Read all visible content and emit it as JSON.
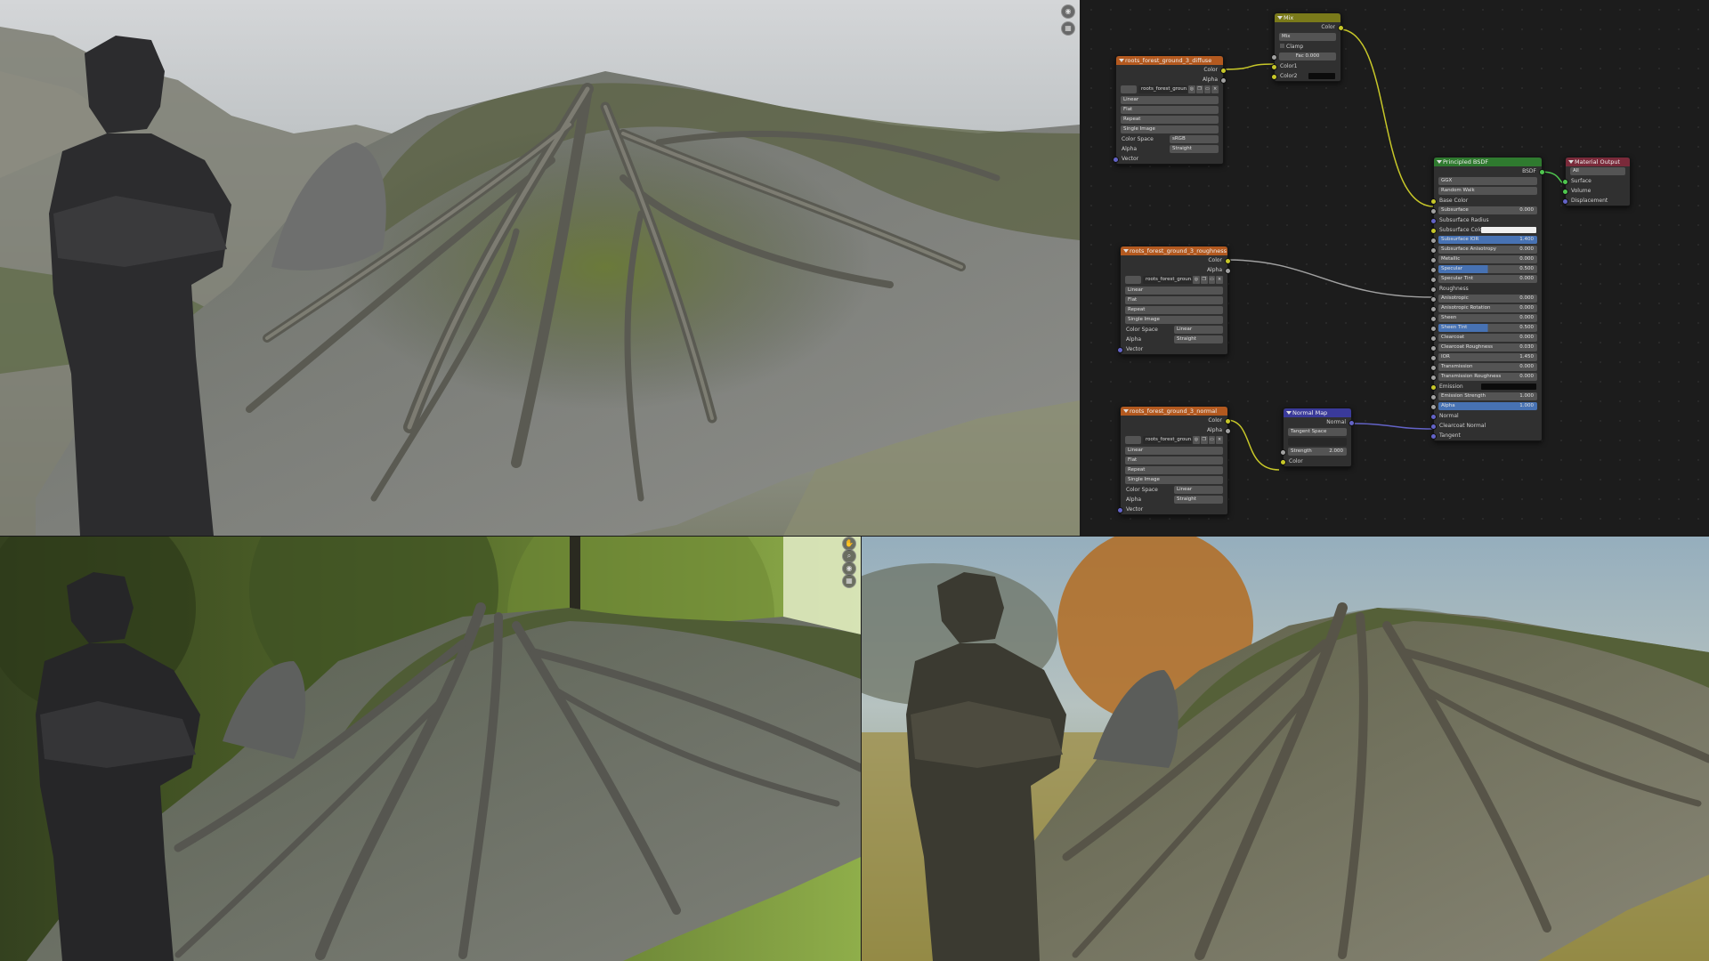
{
  "node_editor": {
    "nodes": {
      "tex_diffuse": {
        "title": "roots_forest_ground_3_diffuse",
        "out_color": "Color",
        "out_alpha": "Alpha",
        "image_name": "roots_forest_groun...",
        "interpolation": "Linear",
        "projection": "Flat",
        "extension": "Repeat",
        "source": "Single Image",
        "color_space_label": "Color Space",
        "color_space": "sRGB",
        "alpha_label": "Alpha",
        "alpha_mode": "Straight",
        "in_vector": "Vector"
      },
      "tex_roughness": {
        "title": "roots_forest_ground_3_roughness",
        "out_color": "Color",
        "out_alpha": "Alpha",
        "image_name": "roots_forest_groun...",
        "interpolation": "Linear",
        "projection": "Flat",
        "extension": "Repeat",
        "source": "Single Image",
        "color_space_label": "Color Space",
        "color_space": "Linear",
        "alpha_label": "Alpha",
        "alpha_mode": "Straight",
        "in_vector": "Vector"
      },
      "tex_normal": {
        "title": "roots_forest_ground_3_normal",
        "out_color": "Color",
        "out_alpha": "Alpha",
        "image_name": "roots_forest_groun...",
        "interpolation": "Linear",
        "projection": "Flat",
        "extension": "Repeat",
        "source": "Single Image",
        "color_space_label": "Color Space",
        "color_space": "Linear",
        "alpha_label": "Alpha",
        "alpha_mode": "Straight",
        "in_vector": "Vector"
      },
      "mix": {
        "title": "Mix",
        "out_color": "Color",
        "blend": "Mix",
        "clamp": "Clamp",
        "fac_label": "Fac",
        "fac_value": "0.000",
        "in_color1": "Color1",
        "in_color2": "Color2"
      },
      "normal_map": {
        "title": "Normal Map",
        "out_normal": "Normal",
        "space": "Tangent Space",
        "uv": "",
        "strength_label": "Strength",
        "strength_value": "2.000",
        "in_color": "Color"
      },
      "bsdf": {
        "title": "Principled BSDF",
        "out_bsdf": "BSDF",
        "distribution": "GGX",
        "subsurface_method": "Random Walk",
        "base_color": "Base Color",
        "subsurface_label": "Subsurface",
        "subsurface": "0.000",
        "subsurface_radius": "Subsurface Radius",
        "subsurface_color": "Subsurface Color",
        "subsurface_ior_label": "Subsurface IOR",
        "subsurface_ior": "1.400",
        "subsurface_aniso_label": "Subsurface Anisotropy",
        "subsurface_aniso": "0.000",
        "metallic_label": "Metallic",
        "metallic": "0.000",
        "specular_label": "Specular",
        "specular": "0.500",
        "specular_tint_label": "Specular Tint",
        "specular_tint": "0.000",
        "roughness": "Roughness",
        "anisotropic_label": "Anisotropic",
        "anisotropic": "0.000",
        "aniso_rot_label": "Anisotropic Rotation",
        "aniso_rot": "0.000",
        "sheen_label": "Sheen",
        "sheen": "0.000",
        "sheen_tint_label": "Sheen Tint",
        "sheen_tint": "0.500",
        "clearcoat_label": "Clearcoat",
        "clearcoat": "0.000",
        "clearcoat_rough_label": "Clearcoat Roughness",
        "clearcoat_rough": "0.030",
        "ior_label": "IOR",
        "ior": "1.450",
        "transmission_label": "Transmission",
        "transmission": "0.000",
        "trans_rough_label": "Transmission Roughness",
        "trans_rough": "0.000",
        "emission": "Emission",
        "emission_strength_label": "Emission Strength",
        "emission_strength": "1.000",
        "alpha_label": "Alpha",
        "alpha": "1.000",
        "normal": "Normal",
        "clearcoat_normal": "Clearcoat Normal",
        "tangent": "Tangent"
      },
      "output": {
        "title": "Material Output",
        "target": "All",
        "surface": "Surface",
        "volume": "Volume",
        "displacement": "Displacement"
      }
    }
  },
  "viewport_icons": {
    "top_view": [
      "camera-icon",
      "grid-icon"
    ],
    "bottom_left": [
      "hand-icon",
      "zoom-icon",
      "camera-icon",
      "grid-icon"
    ]
  },
  "colors": {
    "texture_header": "#b3591f",
    "mix_header": "#7a7a1a",
    "bsdf_header": "#2f7a2f",
    "output_header": "#7a2a3a",
    "normal_map_header": "#3a3a9a",
    "color_socket": "#c7c729",
    "vector_socket": "#6363c7",
    "shader_socket": "#4fc74f",
    "field_active": "#4772b3"
  }
}
